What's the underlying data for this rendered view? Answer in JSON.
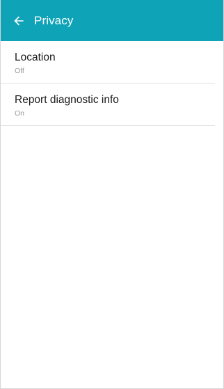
{
  "header": {
    "title": "Privacy",
    "back_icon": "arrow-left-icon",
    "background": "#0fa3b8"
  },
  "settings": [
    {
      "title": "Location",
      "status": "Off"
    },
    {
      "title": "Report diagnostic info",
      "status": "On"
    }
  ]
}
